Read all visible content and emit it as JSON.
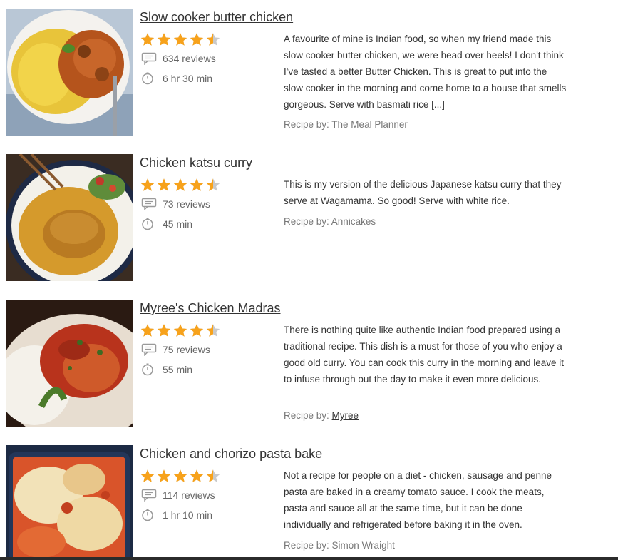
{
  "recipes": [
    {
      "title": "Slow cooker butter chicken",
      "rating": 4.5,
      "reviews": "634 reviews",
      "time": "6 hr 30 min",
      "description": "A favourite of mine is Indian food, so when my friend made this slow cooker butter chicken, we were head over heels! I don't think I've tasted a better Butter Chicken. This is great to put into the slow cooker in the morning and come home to a house that smells gorgeous. Serve with basmati rice [...]",
      "by_label": "Recipe by: ",
      "author": "The Meal Planner"
    },
    {
      "title": "Chicken katsu curry",
      "rating": 4.5,
      "reviews": "73 reviews",
      "time": "45 min",
      "description": "This is my version of the delicious Japanese katsu curry that they serve at Wagamama. So good! Serve with white rice.",
      "by_label": "Recipe by: ",
      "author": "Annicakes"
    },
    {
      "title": "Myree's Chicken Madras",
      "rating": 4.5,
      "reviews": "75 reviews",
      "time": "55 min",
      "description": "There is nothing quite like authentic Indian food prepared using a traditional recipe. This dish is a must for those of you who enjoy a good old curry. You can cook this curry in the morning and leave it to infuse through out the day to make it even more delicious.",
      "by_label": "Recipe by: ",
      "author": "Myree"
    },
    {
      "title": "Chicken and chorizo pasta bake",
      "rating": 4.5,
      "reviews": "114 reviews",
      "time": "1 hr 10 min",
      "description": "Not a recipe for people on a diet - chicken, sausage and penne pasta are baked in a creamy tomato sauce. I cook the meats, pasta and sauce all at the same time, but it can be done individually and refrigerated before baking it in the oven.",
      "by_label": "Recipe by: ",
      "author": "Simon Wraight"
    }
  ],
  "icons": {
    "star": "star-icon",
    "reviews": "comment-icon",
    "time": "timer-icon"
  },
  "colors": {
    "star_fill": "#f7a21b",
    "star_empty": "#c9c9c9"
  }
}
